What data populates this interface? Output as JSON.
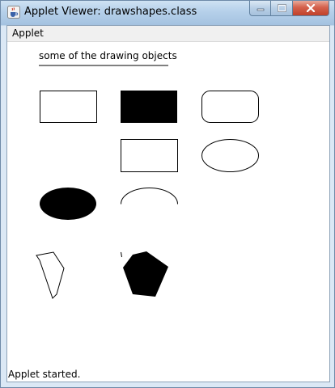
{
  "window": {
    "title": "Applet Viewer: drawshapes.class",
    "icon": "java-cup-icon",
    "controls": [
      "minimize-icon",
      "maximize-icon",
      "close-icon"
    ]
  },
  "menubar": {
    "items": [
      {
        "label": "Applet"
      }
    ]
  },
  "applet": {
    "heading": "some of the drawing objects"
  },
  "statusbar": {
    "text": "Applet started."
  },
  "colors": {
    "title_bar": "#b5d0ea",
    "close_button": "#c74a33",
    "shape_stroke": "#000000",
    "shape_fill": "#000000",
    "background": "#ffffff"
  }
}
